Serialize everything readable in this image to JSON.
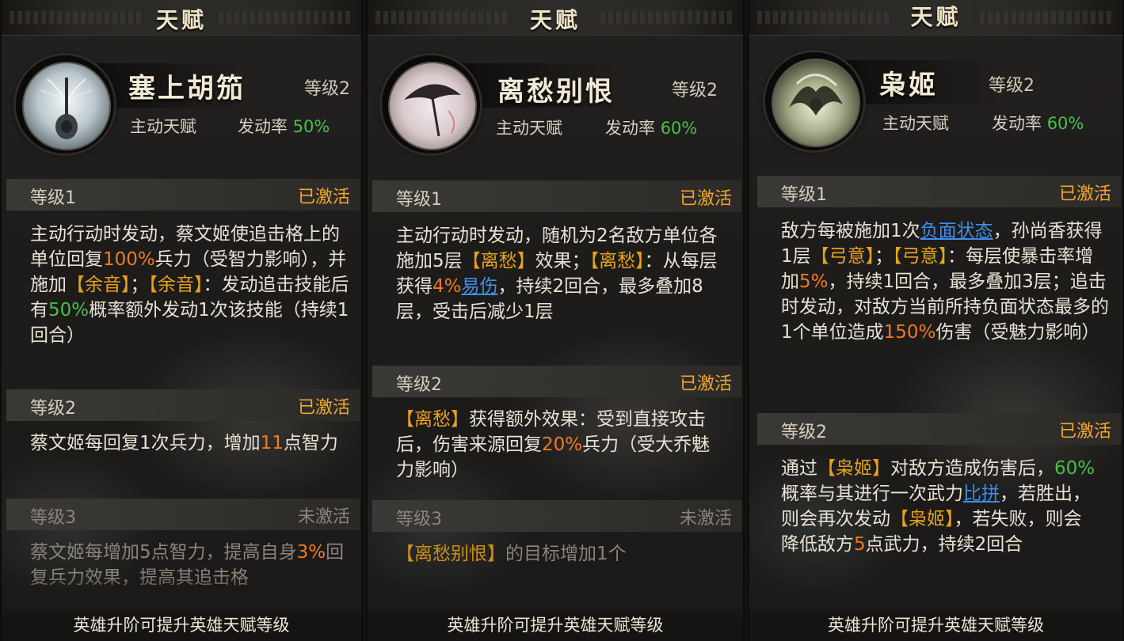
{
  "panels": [
    {
      "title": "天赋",
      "skill_name": "塞上胡笳",
      "level_label": "等级2",
      "type_label": "主动天赋",
      "rate_label": "发动率",
      "rate_value": "50%",
      "levels": [
        {
          "label": "等级1",
          "status": "已激活"
        },
        {
          "label": "等级2",
          "status": "已激活"
        },
        {
          "label": "等级3",
          "status": "未激活"
        }
      ],
      "desc1": {
        "t1": "主动行动时发动，蔡文姬使追击格上的单位回复",
        "v1": "100%",
        "t2": "兵力（受智力影响），并施加",
        "k1": "【余音】",
        "t3": "；",
        "k2": "【余音】",
        "t4": "：发动追击技能后有",
        "v2": "50%",
        "t5": "概率额外发动1次该技能（持续1回合）"
      },
      "desc2": {
        "t1": "蔡文姬每回复1次兵力，增加",
        "v1": "11",
        "t2": "点智力"
      },
      "desc3": {
        "t1": "蔡文姬每增加5点智力，提高自身",
        "v1": "3%",
        "t2": "回复兵力效果，提高其追击格"
      },
      "footer": "英雄升阶可提升英雄天赋等级"
    },
    {
      "title": "天赋",
      "skill_name": "离愁别恨",
      "level_label": "等级2",
      "type_label": "主动天赋",
      "rate_label": "发动率",
      "rate_value": "60%",
      "levels": [
        {
          "label": "等级1",
          "status": "已激活"
        },
        {
          "label": "等级2",
          "status": "已激活"
        },
        {
          "label": "等级3",
          "status": "未激活"
        }
      ],
      "desc1": {
        "t1": "主动行动时发动，随机为2名敌方单位各施加5层",
        "k1": "【离愁】",
        "t2": "效果；",
        "k2": "【离愁】",
        "t3": "：从每层获得",
        "v1": "4%",
        "l1": "易伤",
        "t4": "，持续2回合，最多叠加8层，受击后减少1层"
      },
      "desc2": {
        "k1": "【离愁】",
        "t1": "获得额外效果：受到直接攻击后，伤害来源回复",
        "v1": "20%",
        "t2": "兵力（受大乔魅力影响）"
      },
      "desc3": {
        "k1": "【离愁别恨】",
        "t1": "的目标增加1个"
      },
      "footer": "英雄升阶可提升英雄天赋等级"
    },
    {
      "title": "天赋",
      "skill_name": "枭姬",
      "level_label": "等级2",
      "type_label": "主动天赋",
      "rate_label": "发动率",
      "rate_value": "60%",
      "levels": [
        {
          "label": "等级1",
          "status": "已激活"
        },
        {
          "label": "等级2",
          "status": "已激活"
        }
      ],
      "desc1": {
        "t1": "敌方每被施加1次",
        "l1": "负面状态",
        "t2": "，孙尚香获得1层",
        "k1": "【弓意】",
        "t3": "；",
        "k2": "【弓意】",
        "t4": "：每层使暴击率增加",
        "v1": "5%",
        "t5": "，持续1回合，最多叠加3层；追击时发动，对敌方当前所持负面状态最多的1个单位造成",
        "v2": "150%",
        "t6": "伤害（受魅力影响）"
      },
      "desc2": {
        "t1": "通过",
        "k1": "【枭姬】",
        "t2": "对敌方造成伤害后，",
        "v1": "60%",
        "t3": "概率与其进行一次武力",
        "l1": "比拼",
        "t4": "，若胜出，则会再次发动",
        "k2": "【枭姬】",
        "t5": "，若失败，则会降低敌方",
        "v2": "5",
        "t6": "点武力，持续2回合"
      },
      "footer": "英雄升阶可提升英雄天赋等级"
    }
  ]
}
